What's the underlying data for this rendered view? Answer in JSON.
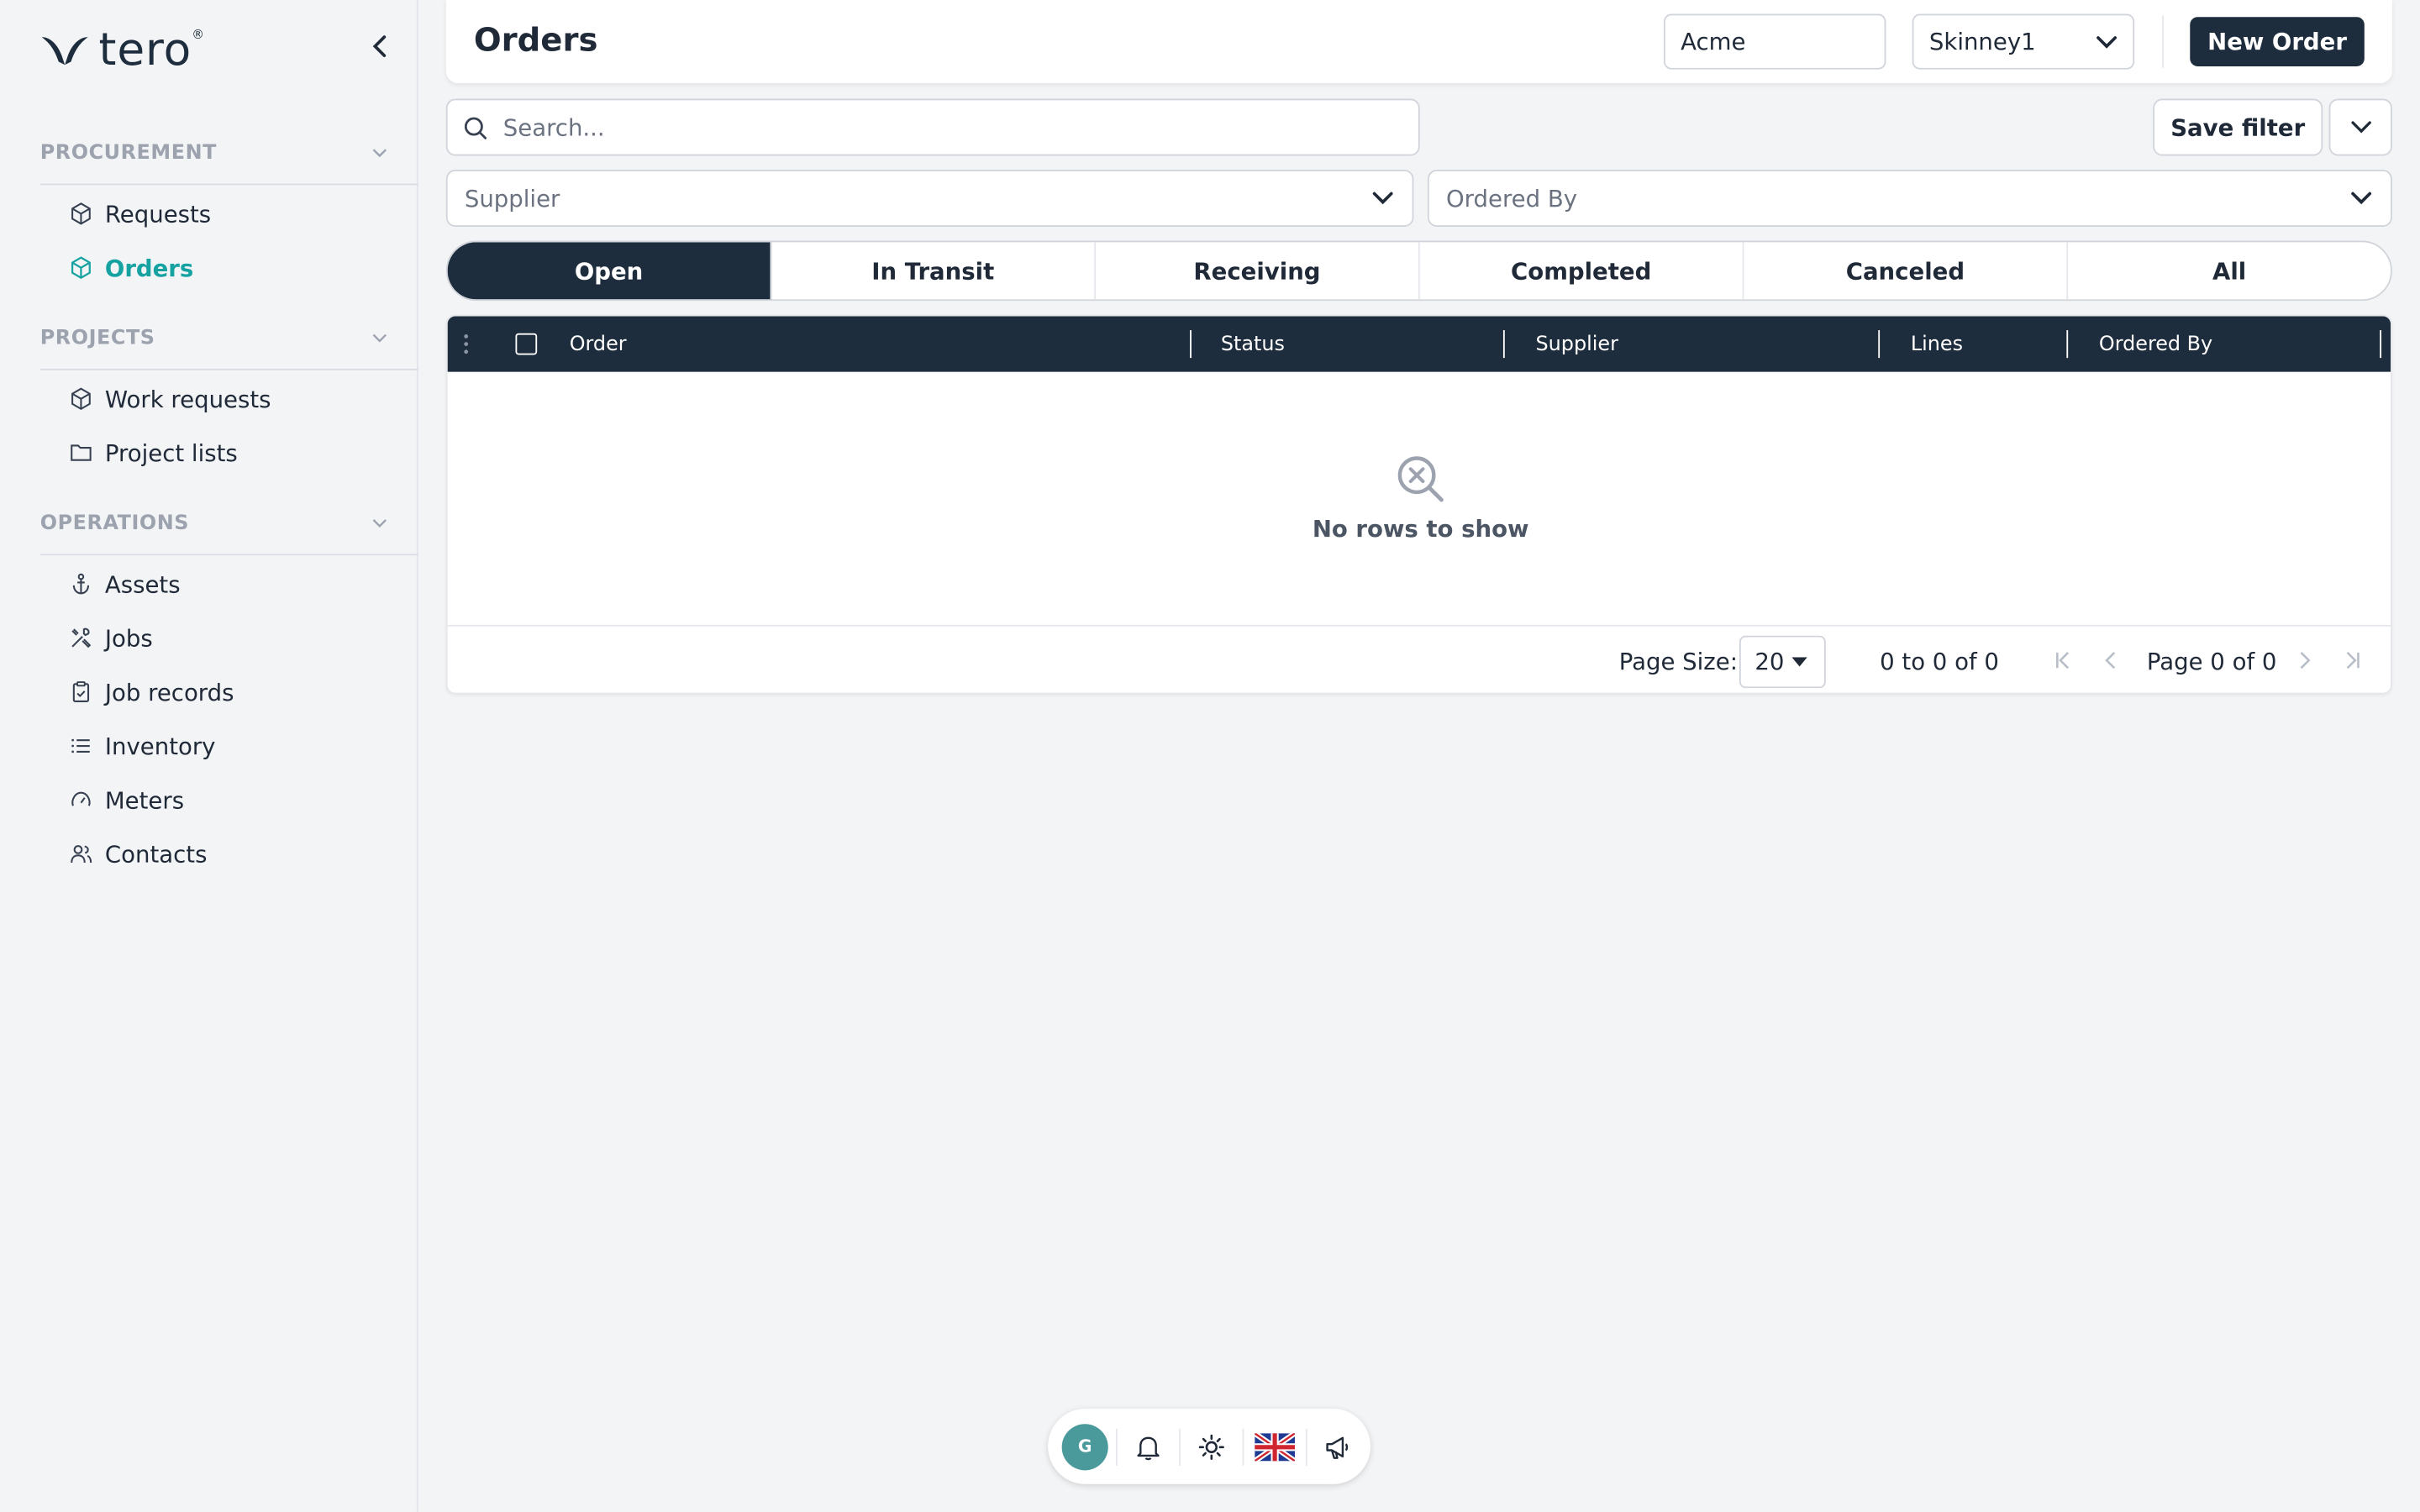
{
  "brand": {
    "logo_text": "tero",
    "logo_mark": "®",
    "color": "#1e2d3d",
    "accent": "#17a2a2"
  },
  "sidebar": {
    "sections": [
      {
        "title": "PROCUREMENT",
        "items": [
          {
            "label": "Requests",
            "icon": "cube-icon"
          },
          {
            "label": "Orders",
            "icon": "cube-icon",
            "active": true
          }
        ]
      },
      {
        "title": "PROJECTS",
        "items": [
          {
            "label": "Work requests",
            "icon": "cube-icon"
          },
          {
            "label": "Project lists",
            "icon": "folder-icon"
          }
        ]
      },
      {
        "title": "OPERATIONS",
        "items": [
          {
            "label": "Assets",
            "icon": "anchor-icon"
          },
          {
            "label": "Jobs",
            "icon": "tools-icon"
          },
          {
            "label": "Job records",
            "icon": "clipboard-icon"
          },
          {
            "label": "Inventory",
            "icon": "list-icon"
          },
          {
            "label": "Meters",
            "icon": "gauge-icon"
          },
          {
            "label": "Contacts",
            "icon": "users-icon"
          }
        ]
      }
    ]
  },
  "header": {
    "title": "Orders",
    "company_value": "Acme",
    "site_value": "Skinney1",
    "new_order_label": "New Order"
  },
  "search": {
    "placeholder": "Search..."
  },
  "filters": {
    "save_filter_label": "Save filter",
    "supplier_placeholder": "Supplier",
    "ordered_by_placeholder": "Ordered By"
  },
  "tabs": [
    {
      "label": "Open",
      "active": true
    },
    {
      "label": "In Transit"
    },
    {
      "label": "Receiving"
    },
    {
      "label": "Completed"
    },
    {
      "label": "Canceled"
    },
    {
      "label": "All"
    }
  ],
  "grid": {
    "columns": [
      "Order",
      "Status",
      "Supplier",
      "Lines",
      "Ordered By"
    ],
    "empty_text": "No rows to show"
  },
  "pager": {
    "page_size_label": "Page Size:",
    "page_size_value": "20",
    "range_text": "0 to 0 of 0",
    "page_text": "Page 0 of 0"
  },
  "bottom_bar": {
    "avatar_initial": "G",
    "avatar_color": "#4a9a9c"
  }
}
